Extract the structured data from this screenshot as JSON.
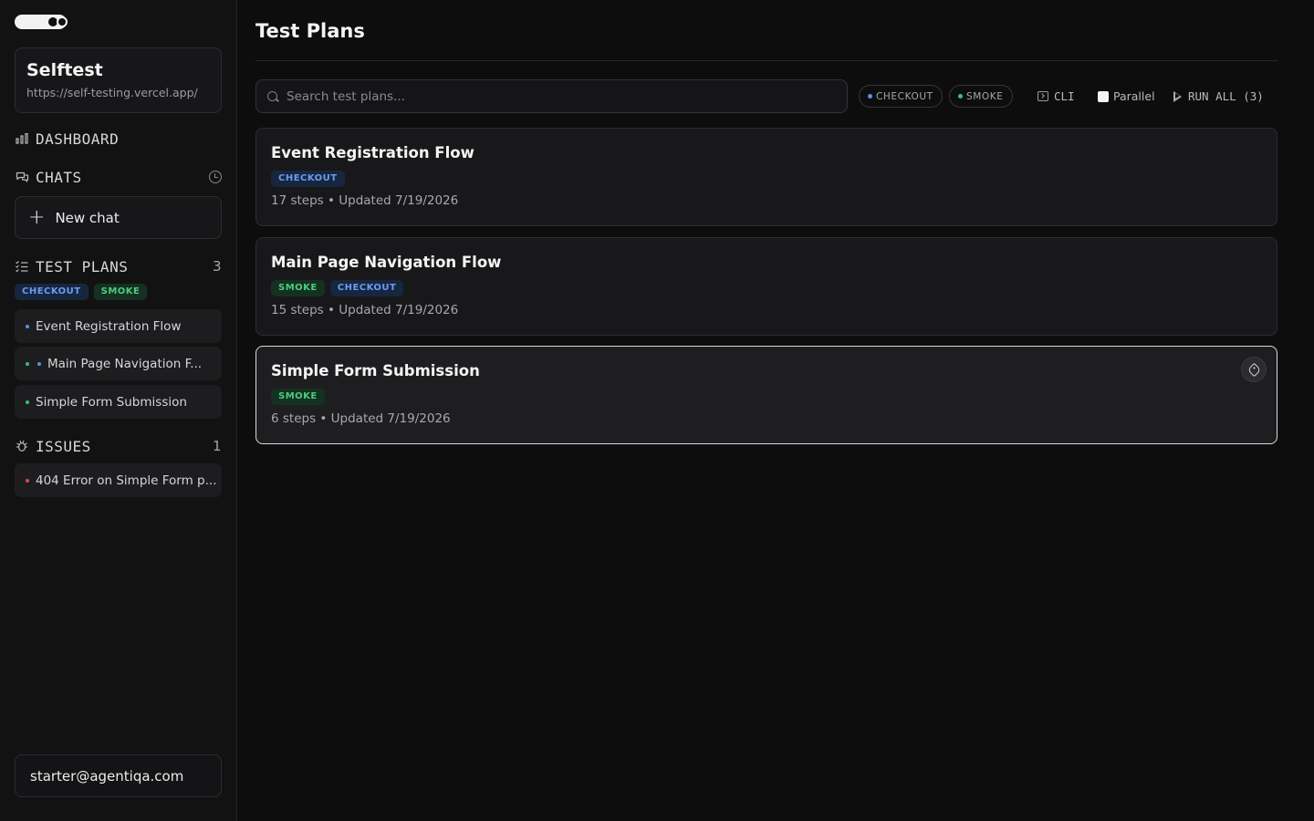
{
  "sidebar": {
    "project": {
      "name": "Selftest",
      "url": "https://self-testing.vercel.app/"
    },
    "dashboard_label": "DASHBOARD",
    "chats_label": "CHATS",
    "new_chat_label": "New chat",
    "test_plans": {
      "label": "TEST PLANS",
      "count": "3",
      "tags": [
        "CHECKOUT",
        "SMOKE"
      ],
      "items": [
        {
          "label": "Event Registration Flow",
          "dots": [
            "blue"
          ]
        },
        {
          "label": "Main Page Navigation F...",
          "dots": [
            "green",
            "blue"
          ]
        },
        {
          "label": "Simple Form Submission",
          "dots": [
            "green"
          ]
        }
      ]
    },
    "issues": {
      "label": "ISSUES",
      "count": "1",
      "items": [
        {
          "label": "404 Error on Simple Form p...",
          "dots": [
            "red"
          ]
        }
      ]
    },
    "user_email": "starter@agentiqa.com"
  },
  "main": {
    "title": "Test Plans",
    "search_placeholder": "Search test plans...",
    "filters": [
      {
        "label": "CHECKOUT",
        "color": "#5b8def"
      },
      {
        "label": "SMOKE",
        "color": "#3fbf6f"
      }
    ],
    "cli_label": "CLI",
    "parallel_label": "Parallel",
    "run_all_label": "RUN ALL (3)",
    "plans": [
      {
        "title": "Event Registration Flow",
        "tags": [
          "CHECKOUT"
        ],
        "meta": "17 steps • Updated 7/19/2026"
      },
      {
        "title": "Main Page Navigation Flow",
        "tags": [
          "SMOKE",
          "CHECKOUT"
        ],
        "meta": "15 steps • Updated 7/19/2026"
      },
      {
        "title": "Simple Form Submission",
        "tags": [
          "SMOKE"
        ],
        "meta": "6 steps • Updated 7/19/2026"
      }
    ]
  },
  "colors": {
    "checkout": "#6b9cf2",
    "smoke": "#4ecb7e",
    "issue": "#e04848"
  }
}
